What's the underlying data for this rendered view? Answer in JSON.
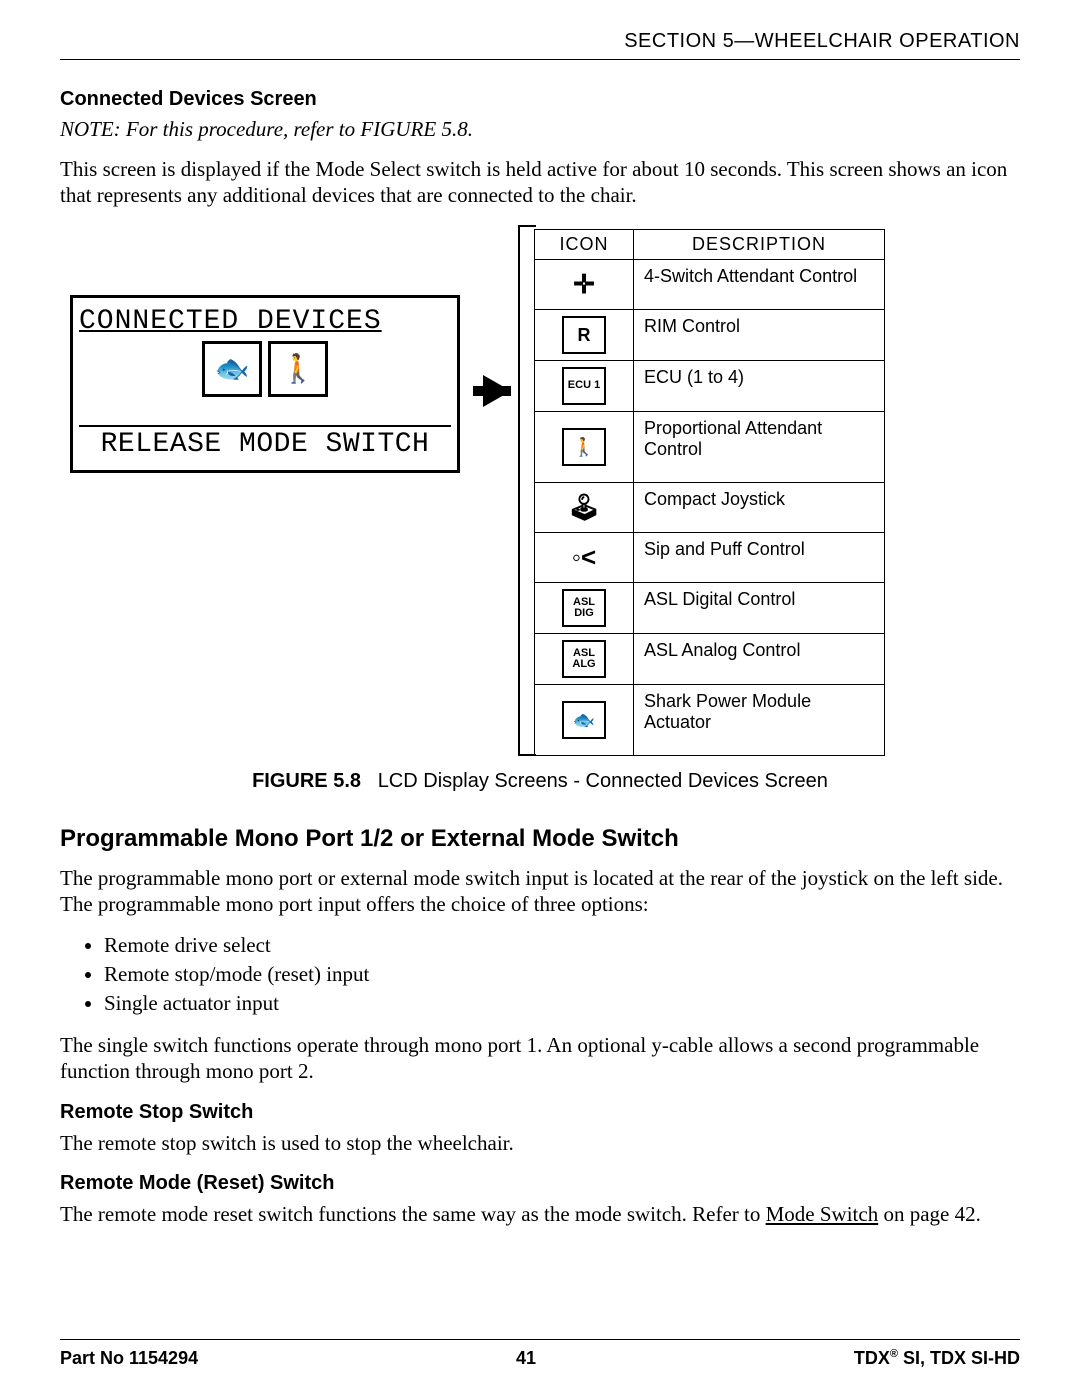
{
  "section_header": "SECTION 5—WHEELCHAIR OPERATION",
  "subsection": {
    "title": "Connected Devices Screen",
    "note": "NOTE: For this procedure, refer to FIGURE 5.8.",
    "intro": "This screen is displayed if the Mode Select switch is held active for about 10 seconds. This screen shows an icon that represents any additional devices that are connected to the chair."
  },
  "lcd": {
    "title": "CONNECTED DEVICES",
    "icon1_name": "shark-icon",
    "icon1_glyph": "🐟",
    "icon2_name": "attendant-icon",
    "icon2_glyph": "🚶",
    "bottom": "RELEASE MODE SWITCH"
  },
  "icon_table": {
    "head_icon": "ICON",
    "head_desc": "DESCRIPTION",
    "rows": [
      {
        "icon_name": "four-switch-attendant-icon",
        "glyph": "✛",
        "border": false,
        "desc": "4-Switch Attendant Control"
      },
      {
        "icon_name": "rim-control-icon",
        "glyph": "R",
        "border": true,
        "desc": "RIM Control"
      },
      {
        "icon_name": "ecu-icon",
        "glyph": "ECU 1",
        "border": true,
        "desc": "ECU (1 to 4)"
      },
      {
        "icon_name": "proportional-attendant-icon",
        "glyph": "🚶",
        "border": true,
        "desc": "Proportional Attendant Control"
      },
      {
        "icon_name": "compact-joystick-icon",
        "glyph": "🕹",
        "border": false,
        "desc": "Compact Joystick"
      },
      {
        "icon_name": "sip-puff-icon",
        "glyph": "◦<",
        "border": false,
        "desc": "Sip and Puff Control"
      },
      {
        "icon_name": "asl-digital-icon",
        "glyph": "ASL\nDIG",
        "border": true,
        "desc": "ASL Digital Control"
      },
      {
        "icon_name": "asl-analog-icon",
        "glyph": "ASL\nALG",
        "border": true,
        "desc": "ASL Analog Control"
      },
      {
        "icon_name": "shark-power-module-icon",
        "glyph": "🐟",
        "border": true,
        "desc": "Shark Power Module Actuator"
      }
    ]
  },
  "figure_caption": {
    "num": "FIGURE 5.8",
    "text": "LCD Display Screens - Connected Devices Screen"
  },
  "section2": {
    "title": "Programmable Mono Port 1/2 or External Mode Switch",
    "p1": "The programmable mono port or external mode switch input is located at the rear of the joystick on the left side. The programmable mono port input offers the choice of three options:",
    "bullets": [
      "Remote drive select",
      "Remote stop/mode (reset) input",
      "Single actuator input"
    ],
    "p2": "The single switch functions operate through mono port 1. An optional y-cable allows a second programmable function through mono port 2."
  },
  "section3": {
    "title": "Remote Stop Switch",
    "p": "The remote stop switch is used to stop the wheelchair."
  },
  "section4": {
    "title": "Remote Mode (Reset) Switch",
    "p_pre": "The remote mode reset switch functions the same way as the mode switch. Refer to ",
    "link": "Mode Switch",
    "p_post": " on page 42."
  },
  "footer": {
    "left": "Part No 1154294",
    "center": "41",
    "right_pre": "TDX",
    "right_sup": "®",
    "right_post": " SI, TDX SI-HD"
  }
}
